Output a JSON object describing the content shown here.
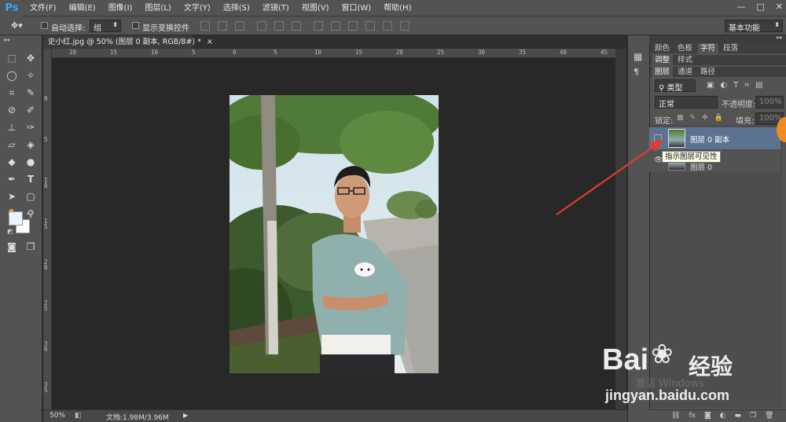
{
  "app": {
    "logo": "Ps"
  },
  "menubar": {
    "items": [
      "文件(F)",
      "编辑(E)",
      "图像(I)",
      "图层(L)",
      "文字(Y)",
      "选择(S)",
      "滤镜(T)",
      "视图(V)",
      "窗口(W)",
      "帮助(H)"
    ],
    "window_controls": [
      "—",
      "□",
      "✕"
    ]
  },
  "options_bar": {
    "auto_select_label": "自动选择:",
    "auto_select_value": "组",
    "show_transform_label": "显示变换控件",
    "workspace_value": "基本功能"
  },
  "document": {
    "tab_title": "史小红.jpg @ 50% (图层 0 副本, RGB/8#) *",
    "tab_close": "×",
    "zoom": "50%",
    "doc_info": "文档:1.98M/3.96M",
    "ruler_h_ticks": [
      "20",
      "15",
      "10",
      "5",
      "0",
      "5",
      "10",
      "15",
      "20",
      "25",
      "30",
      "35",
      "40",
      "45"
    ],
    "ruler_v_ticks": [
      "0",
      "5",
      "1 0",
      "1 5",
      "2 0",
      "2 5",
      "3 0",
      "3 5"
    ]
  },
  "panels": {
    "top_tabs": [
      "颜色",
      "色板",
      "字符",
      "段落"
    ],
    "mid_tabs": [
      "调整",
      "样式"
    ],
    "layer_tabs": [
      "图层",
      "通道",
      "路径"
    ],
    "filter_kind": "类型",
    "blend_mode": "正常",
    "opacity_label": "不透明度:",
    "opacity_value": "100%",
    "lock_label": "锁定:",
    "fill_label": "填充:",
    "fill_value": "100%",
    "layers": [
      {
        "name": "图层 0 副本",
        "selected": true
      },
      {
        "name": "图层 0",
        "selected": false
      }
    ],
    "tooltip": "指示图层可见性"
  },
  "watermark": {
    "activate_text": "激活 Windows",
    "brand": "Bai",
    "brand_suffix": "经验",
    "url": "jingyan.baidu.com"
  },
  "colors": {
    "accent_arrow": "#e23b2f",
    "selected_layer": "#5b7391",
    "notification": "#f08a22"
  }
}
